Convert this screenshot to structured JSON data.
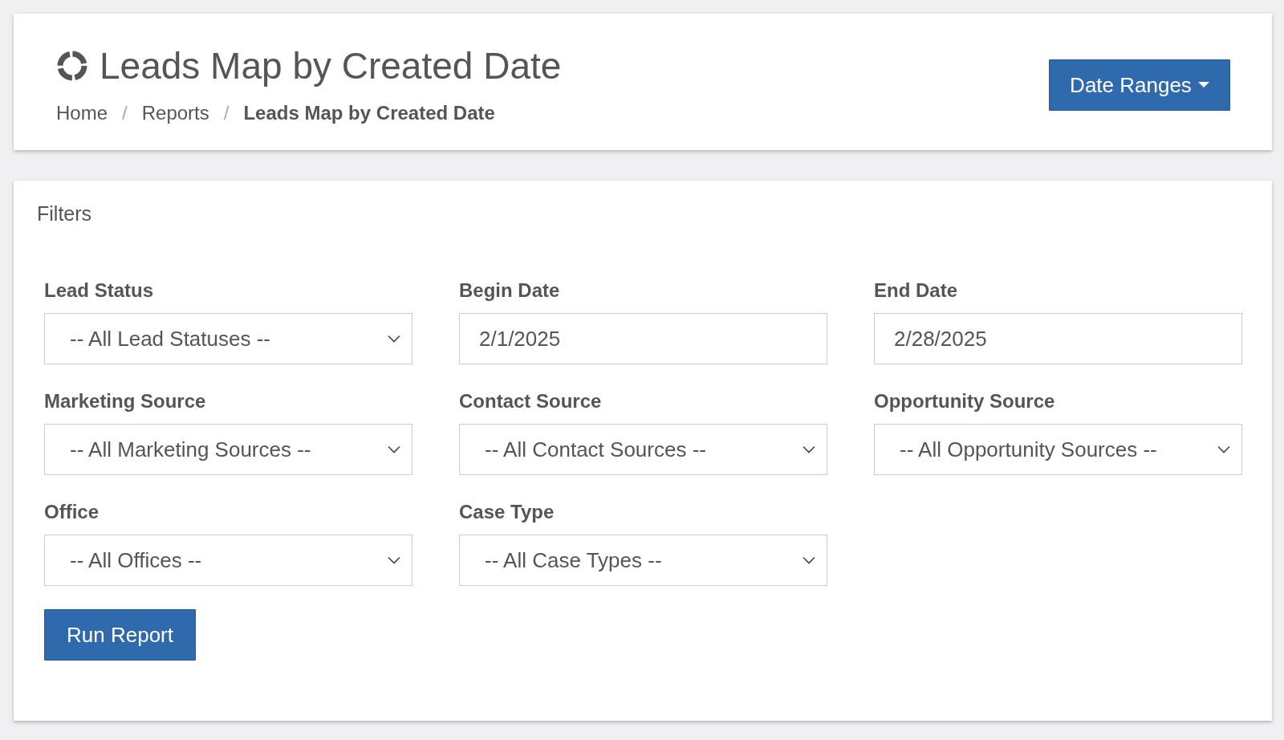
{
  "header": {
    "title": "Leads Map by Created Date",
    "breadcrumb": [
      {
        "label": "Home",
        "current": false
      },
      {
        "label": "Reports",
        "current": false
      },
      {
        "label": "Leads Map by Created Date",
        "current": true
      }
    ],
    "separator": "/",
    "date_ranges_button": "Date Ranges"
  },
  "filters": {
    "title": "Filters",
    "fields": [
      {
        "kind": "select",
        "label": "Lead Status",
        "value": "-- All Lead Statuses --"
      },
      {
        "kind": "date",
        "label": "Begin Date",
        "value": "2/1/2025"
      },
      {
        "kind": "date",
        "label": "End Date",
        "value": "2/28/2025"
      },
      {
        "kind": "select",
        "label": "Marketing Source",
        "value": "-- All Marketing Sources --"
      },
      {
        "kind": "select",
        "label": "Contact Source",
        "value": "-- All Contact Sources --"
      },
      {
        "kind": "select",
        "label": "Opportunity Source",
        "value": "-- All Opportunity Sources --"
      },
      {
        "kind": "select",
        "label": "Office",
        "value": "-- All Offices --"
      },
      {
        "kind": "select",
        "label": "Case Type",
        "value": "-- All Case Types --"
      }
    ],
    "run_button": "Run Report"
  }
}
